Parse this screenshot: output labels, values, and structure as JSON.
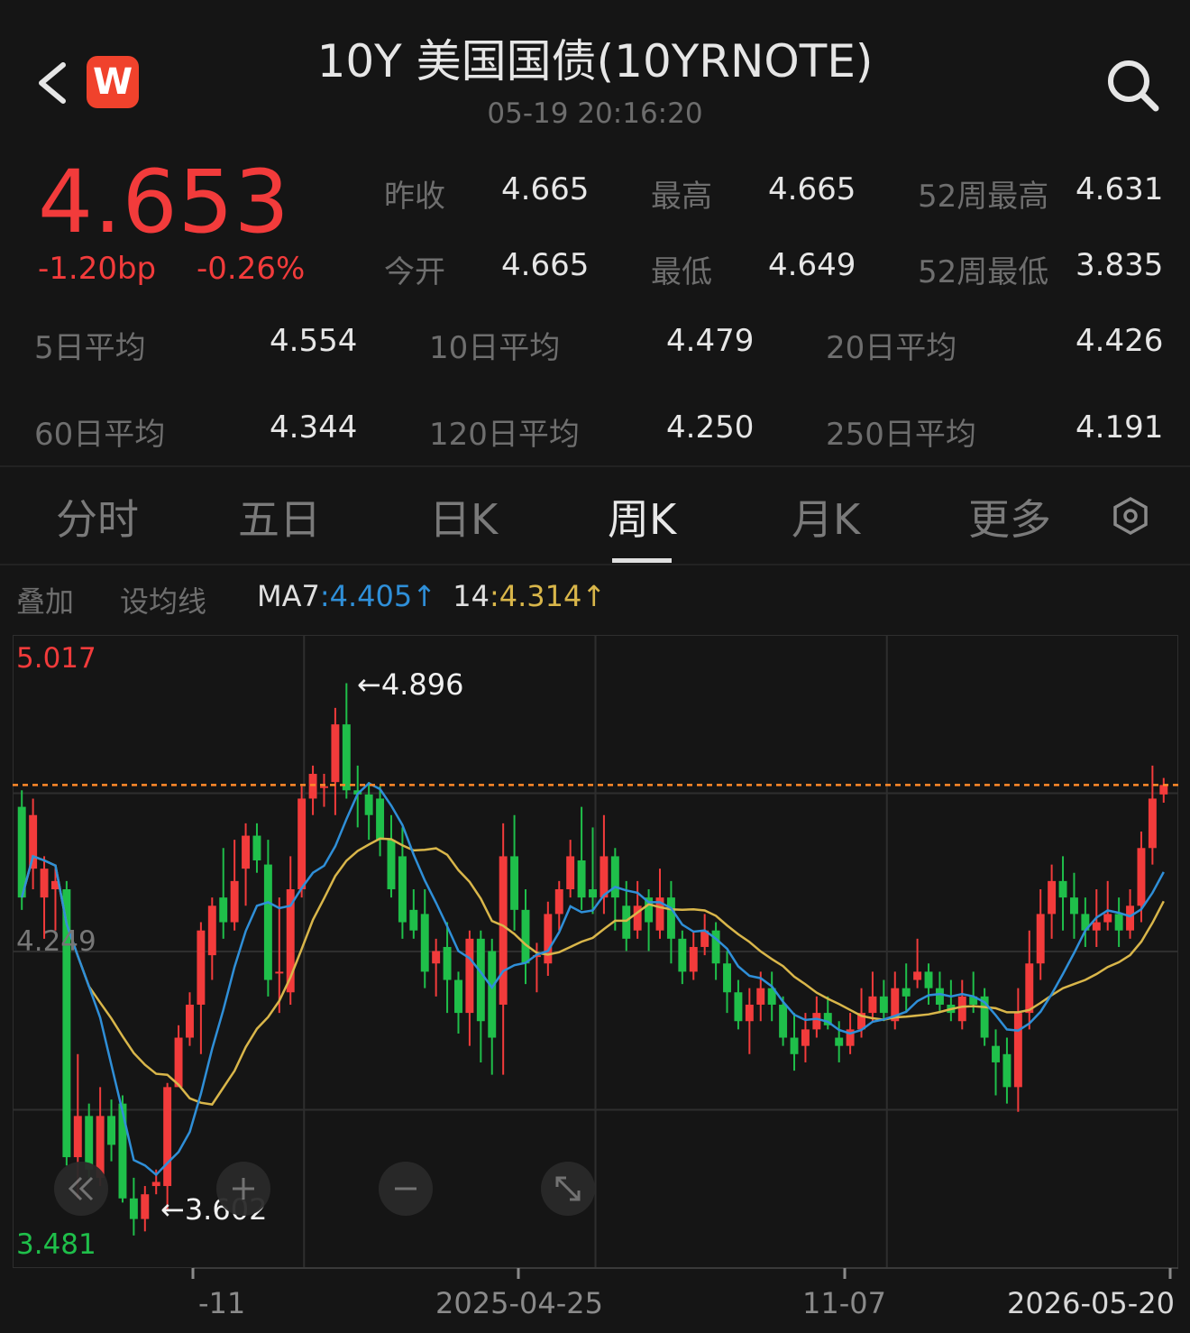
{
  "header": {
    "title": "10Y 美国国债(10YRNOTE)",
    "time": "05-19 20:16:20",
    "logo": "W",
    "back_icon": "chevron-left-icon",
    "search_icon": "search-icon"
  },
  "quote": {
    "price": "4.653",
    "change_bp": "-1.20bp",
    "change_pct": "-0.26%",
    "stats": [
      {
        "label": "昨收",
        "value": "4.665"
      },
      {
        "label": "最高",
        "value": "4.665"
      },
      {
        "label": "52周最高",
        "value": "4.631"
      },
      {
        "label": "今开",
        "value": "4.665"
      },
      {
        "label": "最低",
        "value": "4.649"
      },
      {
        "label": "52周最低",
        "value": "3.835"
      }
    ],
    "ma_rows": [
      {
        "label": "5日平均",
        "value": "4.554"
      },
      {
        "label": "10日平均",
        "value": "4.479"
      },
      {
        "label": "20日平均",
        "value": "4.426"
      },
      {
        "label": "60日平均",
        "value": "4.344"
      },
      {
        "label": "120日平均",
        "value": "4.250"
      },
      {
        "label": "250日平均",
        "value": "4.191"
      }
    ]
  },
  "tabs": [
    {
      "label": "分时"
    },
    {
      "label": "五日"
    },
    {
      "label": "日K"
    },
    {
      "label": "周K",
      "active": true
    },
    {
      "label": "月K"
    },
    {
      "label": "更多"
    }
  ],
  "toolbar": {
    "overlay": "叠加",
    "set_ma": "设均线",
    "ma7_label": "MA7",
    "ma7_sep": ":",
    "ma7_value": "4.405",
    "ma7_arrow": "↑",
    "ma14_label": "14",
    "ma14_sep": ":",
    "ma14_value": "4.314",
    "ma14_arrow": "↑"
  },
  "colors": {
    "up": "#f23b3b",
    "down": "#1fbf4a",
    "ma7": "#2f8fd8",
    "ma14": "#d9b64a",
    "price_line": "#ff8a2a"
  },
  "chart_data": {
    "type": "candlestick",
    "period": "weekly",
    "y_max_label": "5.017",
    "y_min_label": "3.481",
    "y_mid_label": "4.249",
    "ylim": [
      3.481,
      5.017
    ],
    "high_marker": "←4.896",
    "low_marker": "←3.602",
    "current_line": 4.653,
    "x_labels": [
      "-11",
      "2025-04-25",
      "11-07",
      "2026-05-20"
    ],
    "candles": [
      [
        4.6,
        4.38,
        4.64,
        4.35
      ],
      [
        4.45,
        4.58,
        4.62,
        4.4
      ],
      [
        4.38,
        4.45,
        4.48,
        4.28
      ],
      [
        4.4,
        4.42,
        4.45,
        4.3
      ],
      [
        4.4,
        3.75,
        4.42,
        3.73
      ],
      [
        3.75,
        3.85,
        4.0,
        3.65
      ],
      [
        3.85,
        3.72,
        3.88,
        3.7
      ],
      [
        3.7,
        3.85,
        3.92,
        3.68
      ],
      [
        3.85,
        3.78,
        3.89,
        3.74
      ],
      [
        3.88,
        3.65,
        3.9,
        3.64
      ],
      [
        3.65,
        3.6,
        3.7,
        3.56
      ],
      [
        3.6,
        3.66,
        3.68,
        3.57
      ],
      [
        3.68,
        3.69,
        3.72,
        3.66
      ],
      [
        3.68,
        3.92,
        3.93,
        3.62
      ],
      [
        3.92,
        4.04,
        4.07,
        4.0
      ],
      [
        4.04,
        4.12,
        4.15,
        4.02
      ],
      [
        4.12,
        4.3,
        4.32,
        4.0
      ],
      [
        4.24,
        4.36,
        4.38,
        4.18
      ],
      [
        4.38,
        4.32,
        4.5,
        4.28
      ],
      [
        4.32,
        4.42,
        4.52,
        4.3
      ],
      [
        4.45,
        4.53,
        4.56,
        4.36
      ],
      [
        4.53,
        4.47,
        4.56,
        4.44
      ],
      [
        4.46,
        4.18,
        4.52,
        4.14
      ],
      [
        4.2,
        4.2,
        4.38,
        4.1
      ],
      [
        4.15,
        4.4,
        4.48,
        4.12
      ],
      [
        4.4,
        4.62,
        4.65,
        4.38
      ],
      [
        4.62,
        4.68,
        4.7,
        4.58
      ],
      [
        4.65,
        4.65,
        4.68,
        4.6
      ],
      [
        4.66,
        4.8,
        4.84,
        4.58
      ],
      [
        4.8,
        4.64,
        4.9,
        4.62
      ],
      [
        4.64,
        4.63,
        4.7,
        4.55
      ],
      [
        4.63,
        4.58,
        4.66,
        4.52
      ],
      [
        4.62,
        4.52,
        4.65,
        4.48
      ],
      [
        4.52,
        4.4,
        4.58,
        4.38
      ],
      [
        4.48,
        4.32,
        4.55,
        4.28
      ],
      [
        4.35,
        4.3,
        4.4,
        4.28
      ],
      [
        4.34,
        4.2,
        4.4,
        4.16
      ],
      [
        4.22,
        4.25,
        4.28,
        4.14
      ],
      [
        4.26,
        4.18,
        4.32,
        4.1
      ],
      [
        4.18,
        4.1,
        4.2,
        4.05
      ],
      [
        4.1,
        4.28,
        4.3,
        4.02
      ],
      [
        4.28,
        4.08,
        4.3,
        3.98
      ],
      [
        4.25,
        4.04,
        4.28,
        3.95
      ],
      [
        4.12,
        4.48,
        4.56,
        3.95
      ],
      [
        4.48,
        4.35,
        4.58,
        4.3
      ],
      [
        4.35,
        4.22,
        4.4,
        4.17
      ],
      [
        4.24,
        4.24,
        4.27,
        4.15
      ],
      [
        4.22,
        4.34,
        4.37,
        4.19
      ],
      [
        4.34,
        4.4,
        4.42,
        4.3
      ],
      [
        4.4,
        4.48,
        4.52,
        4.38
      ],
      [
        4.47,
        4.38,
        4.6,
        4.35
      ],
      [
        4.4,
        4.38,
        4.55,
        4.34
      ],
      [
        4.38,
        4.48,
        4.58,
        4.34
      ],
      [
        4.48,
        4.38,
        4.5,
        4.3
      ],
      [
        4.36,
        4.28,
        4.42,
        4.25
      ],
      [
        4.3,
        4.36,
        4.42,
        4.28
      ],
      [
        4.38,
        4.32,
        4.4,
        4.25
      ],
      [
        4.3,
        4.38,
        4.45,
        4.28
      ],
      [
        4.38,
        4.28,
        4.42,
        4.22
      ],
      [
        4.28,
        4.2,
        4.3,
        4.17
      ],
      [
        4.2,
        4.26,
        4.3,
        4.18
      ],
      [
        4.26,
        4.3,
        4.34,
        4.24
      ],
      [
        4.3,
        4.22,
        4.32,
        4.18
      ],
      [
        4.22,
        4.15,
        4.25,
        4.1
      ],
      [
        4.15,
        4.08,
        4.18,
        4.06
      ],
      [
        4.08,
        4.12,
        4.16,
        4.0
      ],
      [
        4.12,
        4.16,
        4.2,
        4.08
      ],
      [
        4.16,
        4.12,
        4.2,
        4.08
      ],
      [
        4.12,
        4.04,
        4.14,
        4.02
      ],
      [
        4.04,
        4.0,
        4.1,
        3.96
      ],
      [
        4.02,
        4.06,
        4.1,
        3.98
      ],
      [
        4.06,
        4.1,
        4.14,
        4.04
      ],
      [
        4.1,
        4.07,
        4.14,
        4.06
      ],
      [
        4.04,
        4.02,
        4.08,
        3.98
      ],
      [
        4.02,
        4.06,
        4.1,
        4.0
      ],
      [
        4.06,
        4.1,
        4.16,
        4.04
      ],
      [
        4.1,
        4.14,
        4.2,
        4.08
      ],
      [
        4.14,
        4.1,
        4.18,
        4.08
      ],
      [
        4.08,
        4.16,
        4.2,
        4.06
      ],
      [
        4.16,
        4.14,
        4.22,
        4.1
      ],
      [
        4.18,
        4.2,
        4.28,
        4.16
      ],
      [
        4.2,
        4.16,
        4.22,
        4.12
      ],
      [
        4.16,
        4.12,
        4.2,
        4.1
      ],
      [
        4.12,
        4.1,
        4.18,
        4.08
      ],
      [
        4.08,
        4.14,
        4.18,
        4.06
      ],
      [
        4.14,
        4.12,
        4.2,
        4.1
      ],
      [
        4.14,
        4.04,
        4.16,
        4.02
      ],
      [
        4.02,
        3.98,
        4.06,
        3.9
      ],
      [
        4.0,
        3.92,
        4.04,
        3.88
      ],
      [
        3.92,
        4.1,
        4.16,
        3.86
      ],
      [
        4.1,
        4.22,
        4.3,
        4.06
      ],
      [
        4.22,
        4.34,
        4.4,
        4.18
      ],
      [
        4.34,
        4.42,
        4.46,
        4.28
      ],
      [
        4.42,
        4.38,
        4.48,
        4.3
      ],
      [
        4.38,
        4.34,
        4.44,
        4.28
      ],
      [
        4.34,
        4.3,
        4.38,
        4.26
      ],
      [
        4.3,
        4.32,
        4.4,
        4.26
      ],
      [
        4.32,
        4.34,
        4.42,
        4.3
      ],
      [
        4.34,
        4.3,
        4.38,
        4.26
      ],
      [
        4.3,
        4.36,
        4.4,
        4.28
      ],
      [
        4.36,
        4.5,
        4.54,
        4.32
      ],
      [
        4.5,
        4.62,
        4.7,
        4.46
      ],
      [
        4.63,
        4.653,
        4.67,
        4.61
      ]
    ],
    "ma7": "4.405",
    "ma14": "4.314"
  }
}
